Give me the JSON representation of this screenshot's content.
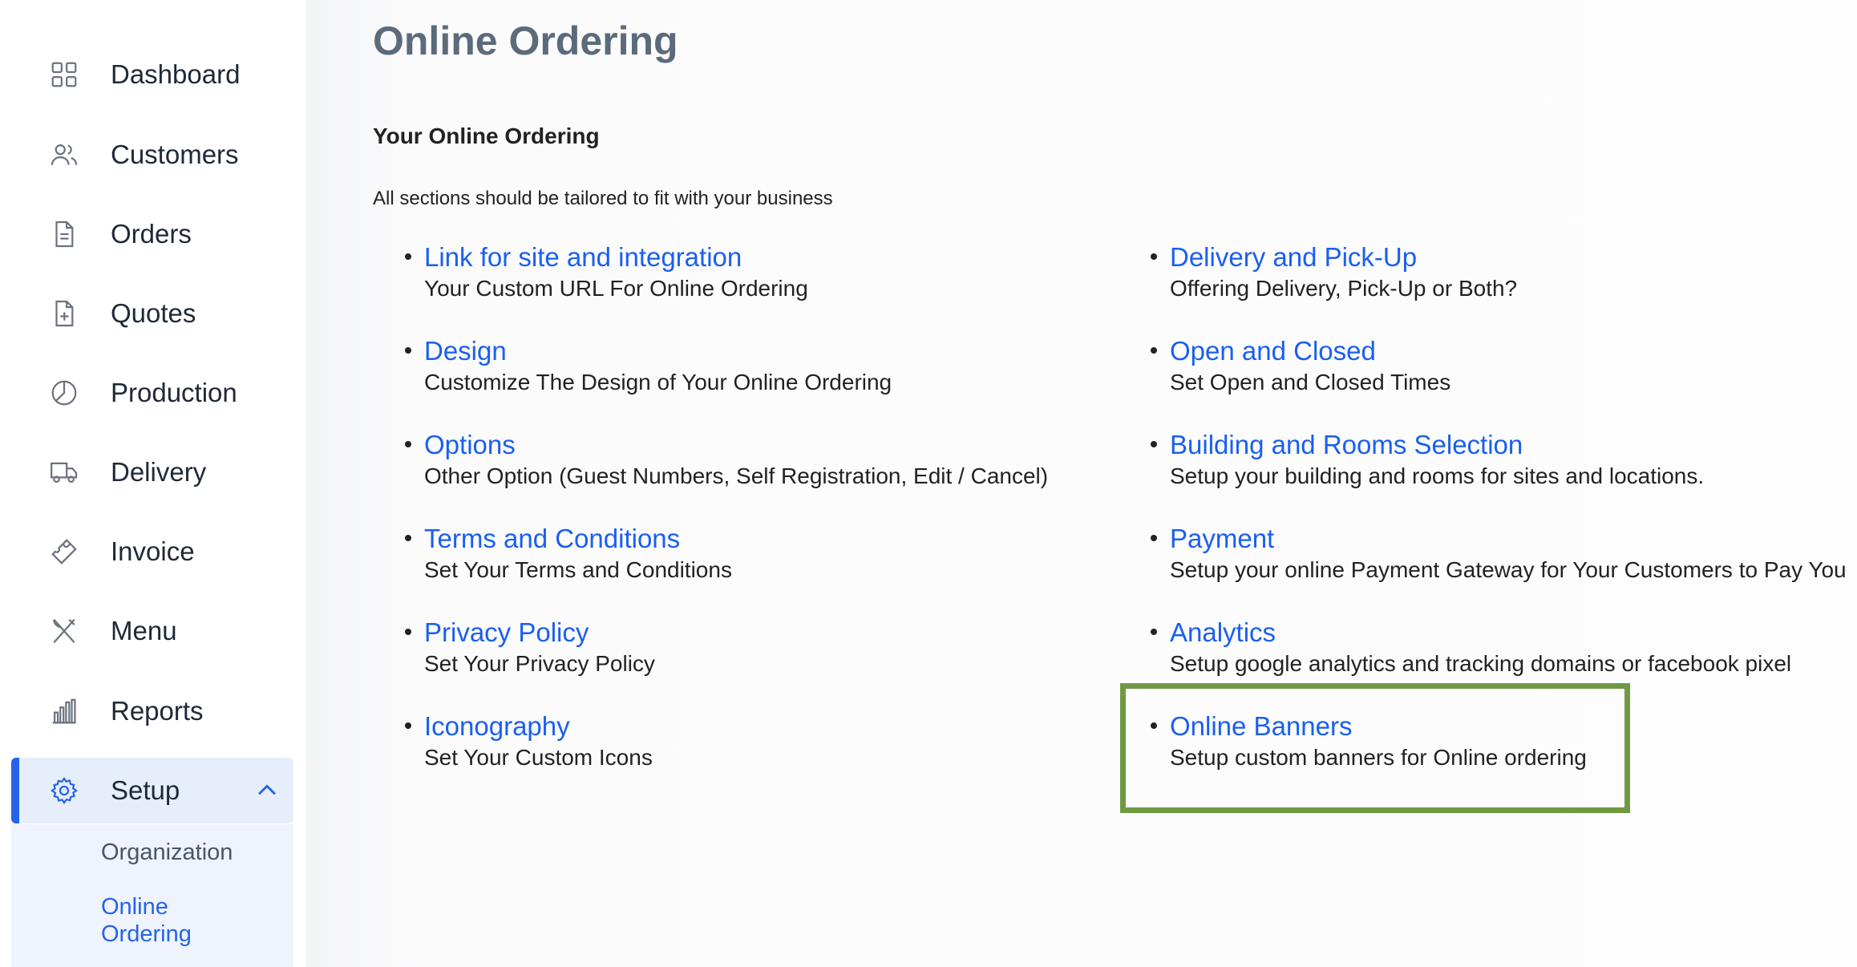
{
  "sidebar": {
    "items": [
      {
        "label": "Dashboard",
        "icon": "grid-icon"
      },
      {
        "label": "Customers",
        "icon": "users-icon"
      },
      {
        "label": "Orders",
        "icon": "document-icon"
      },
      {
        "label": "Quotes",
        "icon": "document-plus-icon"
      },
      {
        "label": "Production",
        "icon": "pie-chart-icon"
      },
      {
        "label": "Delivery",
        "icon": "truck-icon"
      },
      {
        "label": "Invoice",
        "icon": "ticket-icon"
      },
      {
        "label": "Menu",
        "icon": "utensils-icon"
      },
      {
        "label": "Reports",
        "icon": "bar-chart-icon"
      },
      {
        "label": "Setup",
        "icon": "gear-icon",
        "active": true
      }
    ],
    "submenu": {
      "organization": "Organization",
      "online_ordering": "Online Ordering"
    }
  },
  "main": {
    "title": "Online Ordering",
    "section_title": "Your Online Ordering",
    "section_desc": "All sections should be tailored to fit with your business",
    "left_items": [
      {
        "title": "Link for site and integration",
        "desc": "Your Custom URL For Online Ordering"
      },
      {
        "title": "Design",
        "desc": "Customize The Design of Your Online Ordering"
      },
      {
        "title": "Options",
        "desc": "Other Option (Guest Numbers, Self Registration, Edit / Cancel)"
      },
      {
        "title": "Terms and Conditions",
        "desc": "Set Your Terms and Conditions"
      },
      {
        "title": "Privacy Policy",
        "desc": "Set Your Privacy Policy"
      },
      {
        "title": "Iconography",
        "desc": "Set Your Custom Icons"
      }
    ],
    "right_items": [
      {
        "title": "Delivery and Pick-Up",
        "desc": "Offering Delivery, Pick-Up or Both?"
      },
      {
        "title": "Open and Closed",
        "desc": "Set Open and Closed Times"
      },
      {
        "title": "Building and Rooms Selection",
        "desc": "Setup your building and rooms for sites and locations."
      },
      {
        "title": "Payment",
        "desc": "Setup your online Payment Gateway for Your Customers to Pay You"
      },
      {
        "title": "Analytics",
        "desc": "Setup google analytics and tracking domains or facebook pixel"
      },
      {
        "title": "Online Banners",
        "desc": "Setup custom banners for Online ordering"
      }
    ]
  },
  "colors": {
    "link": "#1a5ff0",
    "active_bg": "#e6eefc",
    "accent": "#2563eb",
    "highlight": "#6f9a43"
  }
}
